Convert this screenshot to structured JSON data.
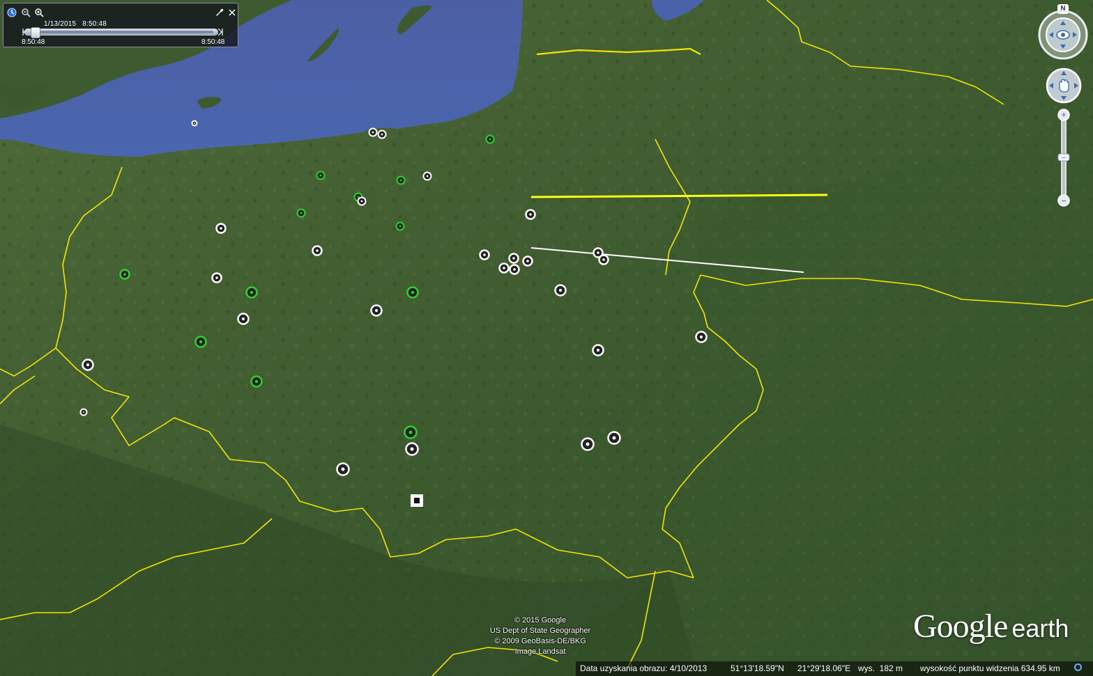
{
  "time_slider": {
    "current_date": "1/13/2015   8:50:48",
    "start_time": "8:50:48",
    "end_time": "8:50:48",
    "icons": [
      "clock-icon",
      "zoom-out-icon",
      "zoom-in-icon",
      "wrench-icon",
      "close-icon"
    ]
  },
  "navigation": {
    "north_label": "N",
    "zoom_plus": "+",
    "zoom_minus": "−"
  },
  "attribution": {
    "line1": "© 2015 Google",
    "line2": "US Dept of State Geographer",
    "line3": "© 2009 GeoBasis-DE/BKG",
    "line4": "Image Landsat"
  },
  "logo": {
    "google": "Google",
    "earth": "earth"
  },
  "status": {
    "image_date": "Data uzyskania obrazu: 4/10/2013",
    "latitude": "51°13'18.59\"N",
    "longitude": "21°29'18.06\"E",
    "elevation": "wys.  182 m",
    "eye_altitude": "wysokość punktu widzenia 634.95 km"
  },
  "colors": {
    "border_line": "#f2e600",
    "path_yellow": "#ffff1a",
    "path_white": "#ffffff",
    "marker_green": "#2fd12f",
    "marker_white": "#ffffff",
    "sea": "#4a62a9"
  }
}
